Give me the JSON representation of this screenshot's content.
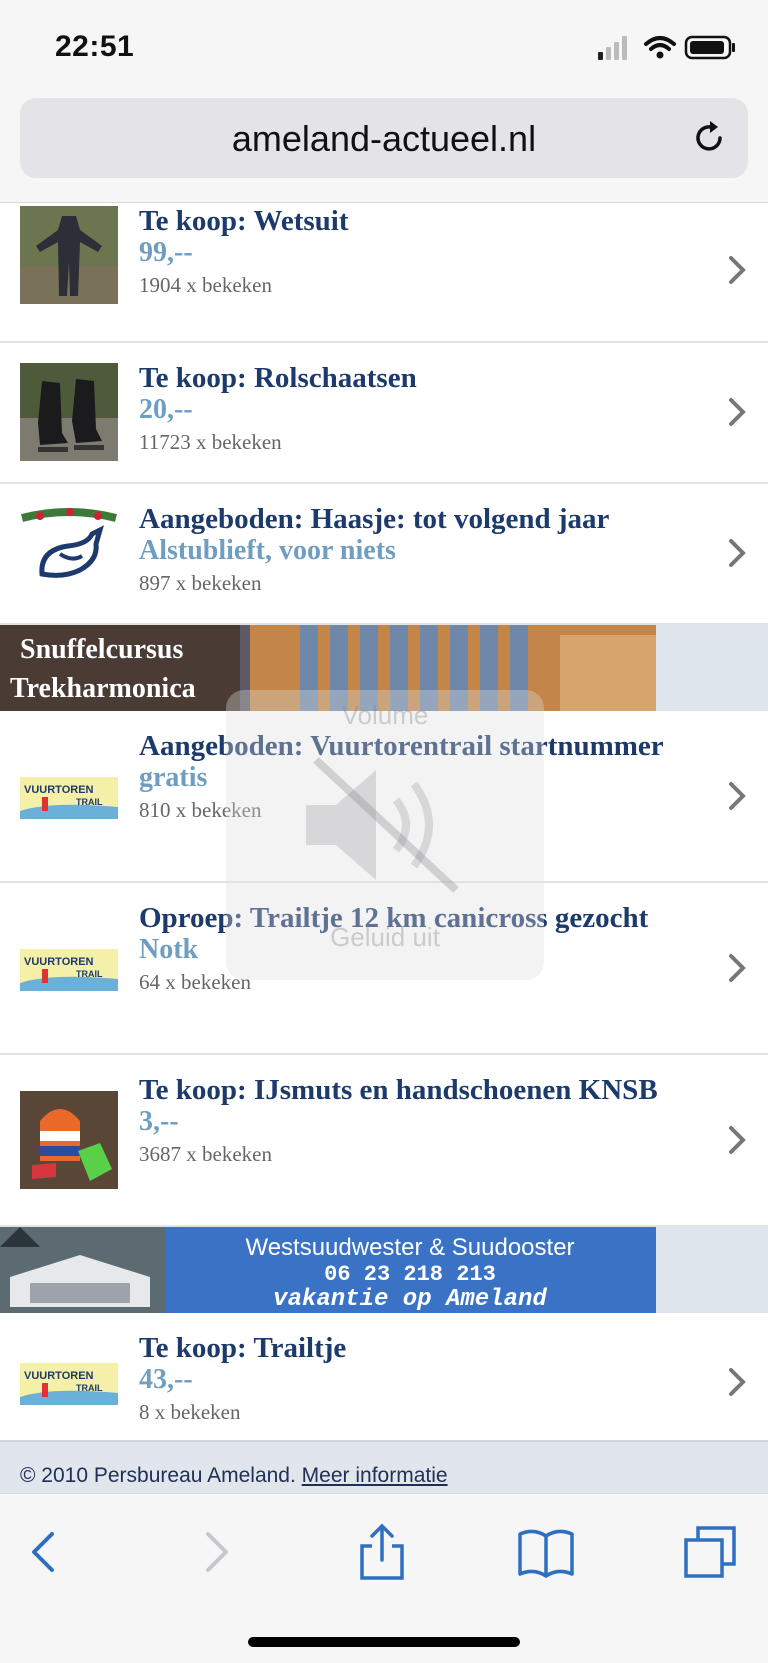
{
  "status_bar": {
    "time": "22:51"
  },
  "browser": {
    "url": "ameland-actueel.nl"
  },
  "listings": [
    {
      "title": "Te koop: Wetsuit",
      "price": "99,--",
      "views": "1904 x bekeken",
      "thumb_icon": "wetsuit-photo"
    },
    {
      "title": "Te koop: Rolschaatsen",
      "price": "20,--",
      "views": "11723 x bekeken",
      "thumb_icon": "skates-photo"
    },
    {
      "title": "Aangeboden: Haasje: tot volgend jaar",
      "price": "Alstublieft, voor niets",
      "views": "897 x bekeken",
      "thumb_icon": "rabbit-logo"
    },
    {
      "title": "Aangeboden: Vuurtorentrail startnummer",
      "price": "gratis",
      "views": "810 x bekeken",
      "thumb_icon": "vuurtoren-trail-logo"
    },
    {
      "title": "Oproep: Trailtje 12 km canicross gezocht",
      "price": "Notk",
      "views": "64 x bekeken",
      "thumb_icon": "vuurtoren-trail-logo"
    },
    {
      "title": "Te koop: IJsmuts en handschoenen KNSB",
      "price": "3,--",
      "views": "3687 x bekeken",
      "thumb_icon": "hat-gloves-photo"
    },
    {
      "title": "Te koop: Trailtje",
      "price": "43,--",
      "views": "8 x bekeken",
      "thumb_icon": "vuurtoren-trail-logo"
    }
  ],
  "thumb_labels": {
    "vuurtoren": "VUURTOREN",
    "trail": "TRAIL"
  },
  "banners": {
    "harmonica": {
      "line1": "Snuffelcursus",
      "line2": "Trekharmonica"
    },
    "westsuud": {
      "line1": "Westsuudwester & Suudooster",
      "line2": "06 23 218 213",
      "line3": "vakantie op Ameland"
    }
  },
  "volume_hud": {
    "title": "Volume",
    "subtitle": "Geluid uit"
  },
  "footer": {
    "copyright": "© 2010 Persbureau Ameland.",
    "link": "Meer informatie"
  },
  "colors": {
    "title": "#1c3a6b",
    "price": "#6f9ec0",
    "link_blue": "#2f6fc1",
    "banner_blue": "#3a73c6"
  }
}
